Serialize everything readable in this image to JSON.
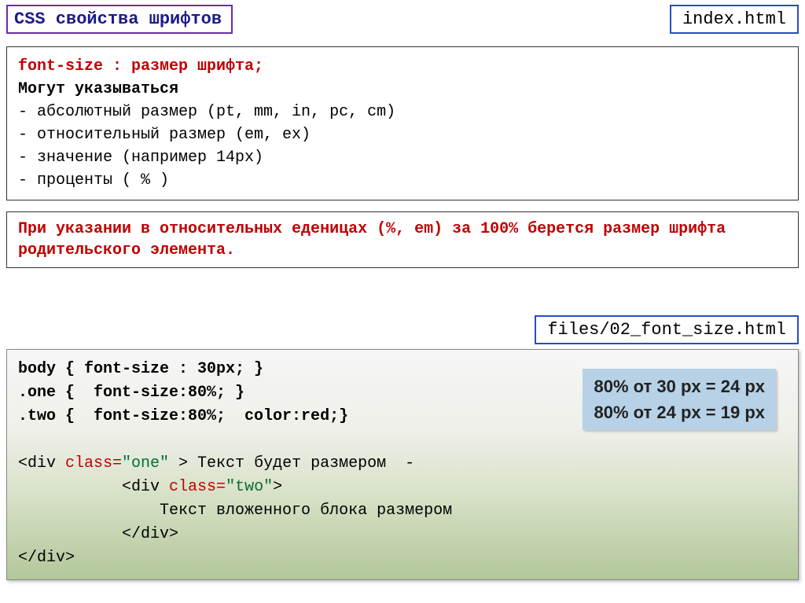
{
  "title": "CSS свойства шрифтов",
  "file1": "index.html",
  "block1": {
    "line1": "font-size : размер  шрифта;",
    "line2": " Могут указываться",
    "line3": " -   абсолютный размер (pt, mm, in, pc, cm)",
    "line4": " -   относительный размер  (em, ex)",
    "line5": " -   значение (например  14px)",
    "line6": " -   проценты ( % )"
  },
  "block2": "При указании в относительных еденицах (%, em) за 100% берется размер шрифта родительского элемента.",
  "file2": "files/02_font_size.html",
  "code": {
    "l1a": "body { font-size : 30px; }",
    "l2a": ".one {  font-size:80%; }",
    "l3a": ".two {  font-size:80%;  color:red;}",
    "blank": "",
    "l4_open": "<div ",
    "l4_attr": "class=",
    "l4_val": "\"one\" ",
    "l4_rest": "> Текст будет размером  -",
    "l5_indent": "           ",
    "l5_open": "<div ",
    "l5_attr": "class=",
    "l5_val": "\"two\"",
    "l5_close": ">",
    "l6": "               Текст вложенного блока размером",
    "l7_indent": "           ",
    "l7_close": "</div>",
    "l8_close": "</div>"
  },
  "calc": {
    "line1": "80% от 30 px = 24 px",
    "line2": "80% от 24 px =  19 px"
  }
}
